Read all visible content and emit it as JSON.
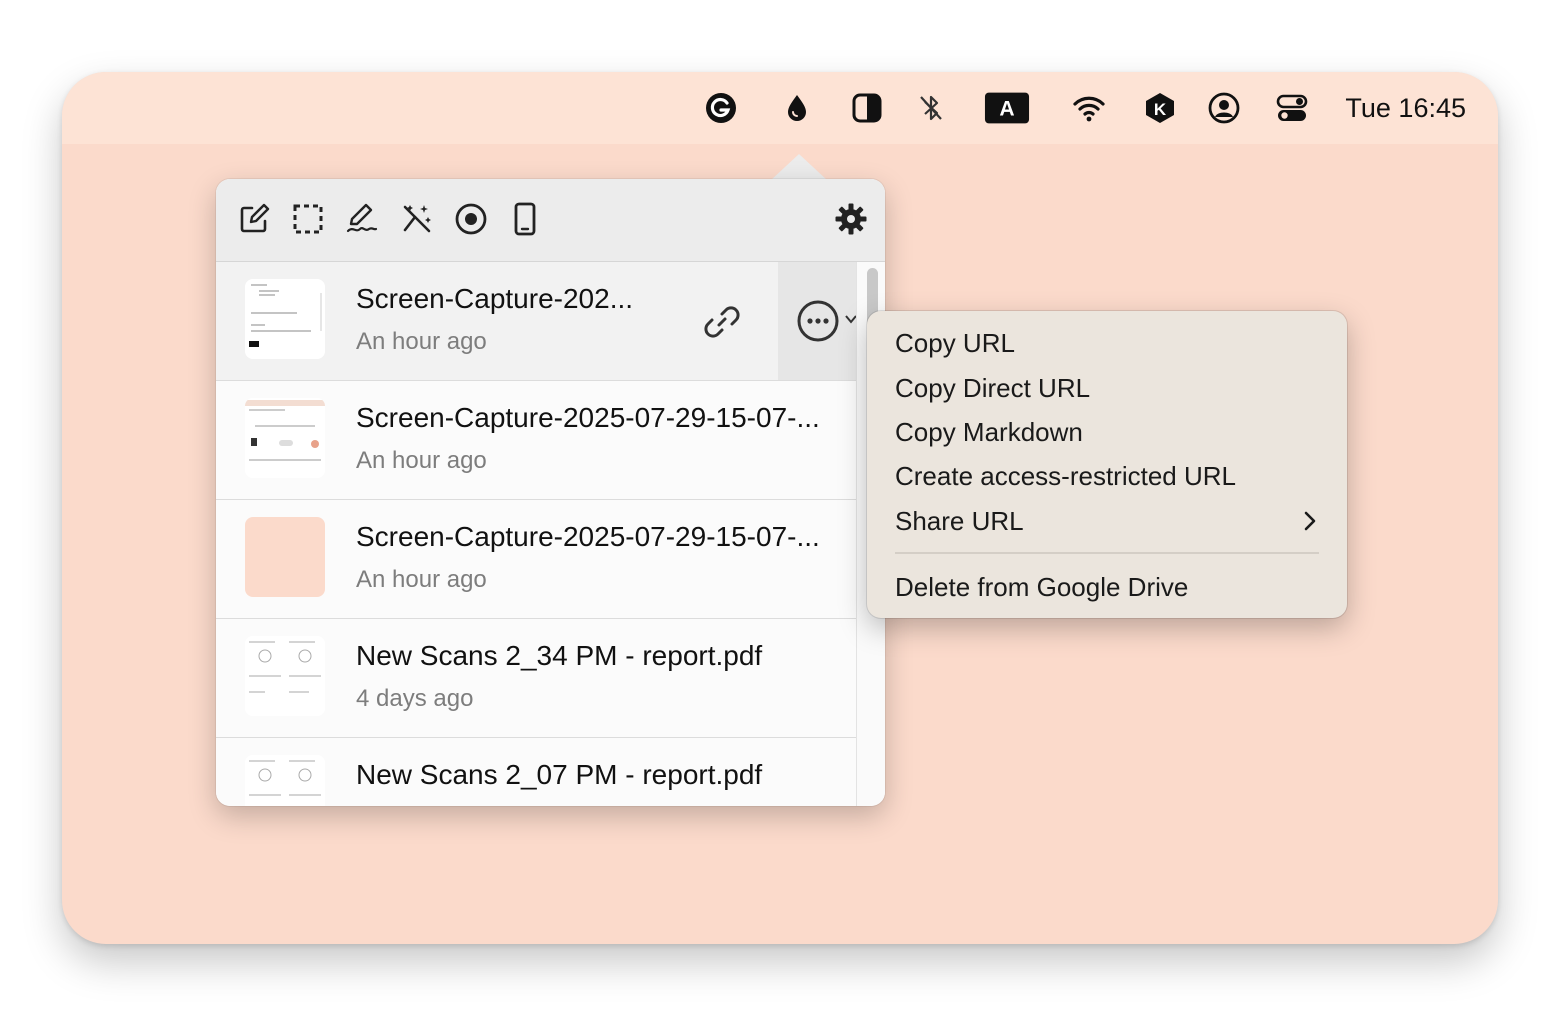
{
  "menubar": {
    "clock": "Tue 16:45",
    "icons": [
      "grammarly-icon",
      "drop-icon",
      "contrast-icon",
      "bluetooth-off-icon",
      "keyboard-input-icon",
      "wifi-icon",
      "k-app-icon",
      "user-account-icon",
      "control-center-icon"
    ],
    "input_label": "A"
  },
  "toolbar": {
    "icons": [
      "edit-icon",
      "region-select-icon",
      "annotate-icon",
      "magic-wand-icon",
      "record-icon",
      "device-icon"
    ],
    "settings_icon": "gear-icon"
  },
  "files": [
    {
      "name": "Screen-Capture-202...",
      "time": "An hour ago"
    },
    {
      "name": "Screen-Capture-2025-07-29-15-07-...",
      "time": "An hour ago"
    },
    {
      "name": "Screen-Capture-2025-07-29-15-07-...",
      "time": "An hour ago"
    },
    {
      "name": "New Scans 2_34 PM - report.pdf",
      "time": "4 days ago"
    },
    {
      "name": "New Scans 2_07 PM - report.pdf",
      "time": ""
    }
  ],
  "context_menu": {
    "items": [
      "Copy URL",
      "Copy Direct URL",
      "Copy Markdown",
      "Create access-restricted URL",
      "Share URL"
    ],
    "delete_item": "Delete from Google Drive"
  },
  "colors": {
    "desktop": "#fbdacb",
    "menubar": "#fde3d5",
    "menu_bg": "#ebe5dd",
    "toolbar_bg": "#ececec"
  }
}
